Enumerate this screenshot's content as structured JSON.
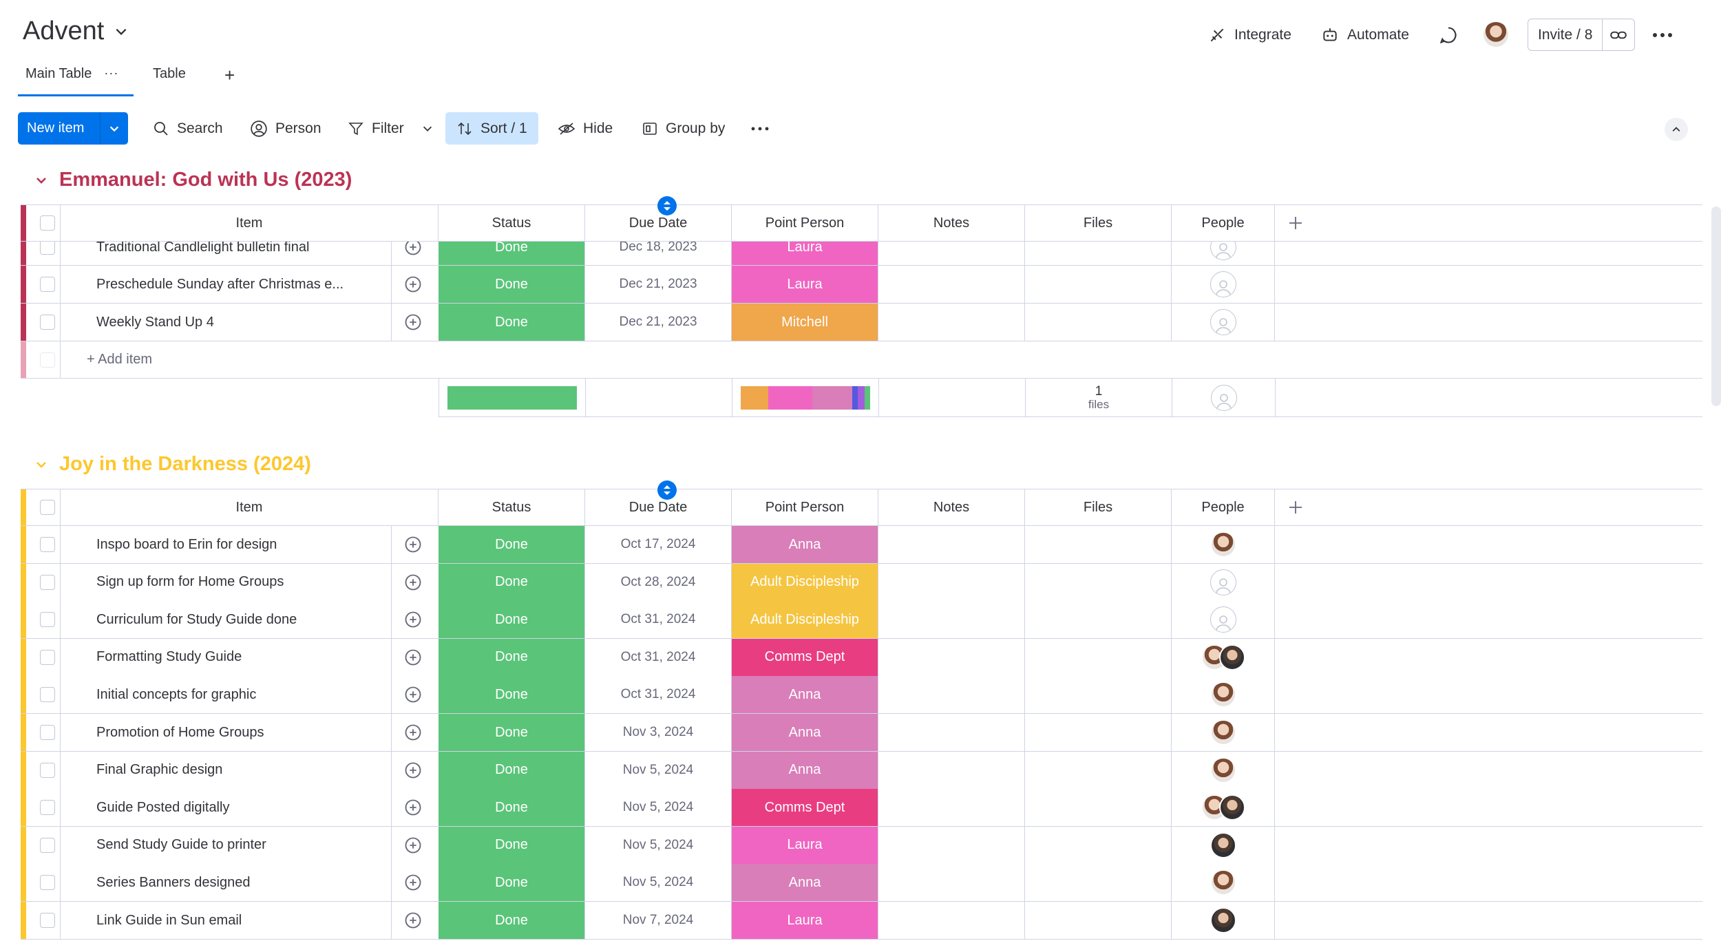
{
  "header": {
    "board_title": "Advent",
    "integrate_label": "Integrate",
    "automate_label": "Automate",
    "invite_label": "Invite / 8"
  },
  "tabs": [
    {
      "label": "Main Table",
      "active": true
    },
    {
      "label": "Table",
      "active": false
    }
  ],
  "toolbar": {
    "new_item_label": "New item",
    "search_label": "Search",
    "person_label": "Person",
    "filter_label": "Filter",
    "sort_label": "Sort / 1",
    "hide_label": "Hide",
    "group_by_label": "Group by"
  },
  "columns": {
    "item": "Item",
    "status": "Status",
    "due_date": "Due Date",
    "point_person": "Point Person",
    "notes": "Notes",
    "files": "Files",
    "people": "People"
  },
  "colors": {
    "done": "#5ac479",
    "laura": "#f065c2",
    "mitchell": "#f0a64b",
    "anna": "#d97eb8",
    "adult_discipleship": "#f5c542",
    "comms_dept": "#e93d82",
    "group1_accent": "#bb3354",
    "group2_accent": "#fdc72d",
    "primary": "#0073ea"
  },
  "groups": [
    {
      "title": "Emmanuel: God with Us (2023)",
      "title_color": "#bb3354",
      "rows": [
        {
          "item": "Traditional Candlelight bulletin final",
          "status": "Done",
          "due": "Dec 18, 2023",
          "pp": "Laura",
          "pp_color": "#f065c2",
          "people": [
            "empty"
          ]
        },
        {
          "item": "Preschedule Sunday after Christmas e...",
          "status": "Done",
          "due": "Dec 21, 2023",
          "pp": "Laura",
          "pp_color": "#f065c2",
          "people": [
            "empty"
          ]
        },
        {
          "item": "Weekly Stand Up 4",
          "status": "Done",
          "due": "Dec 21, 2023",
          "pp": "Mitchell",
          "pp_color": "#f0a64b",
          "people": [
            "empty"
          ]
        }
      ],
      "add_item_label": "+ Add item",
      "summary": {
        "files_count": "1",
        "files_label": "files"
      }
    },
    {
      "title": "Joy in the Darkness (2024)",
      "title_color": "#fdc72d",
      "rows": [
        {
          "item": "Inspo board to Erin for design",
          "status": "Done",
          "due": "Oct 17, 2024",
          "pp": "Anna",
          "pp_color": "#d97eb8",
          "people": [
            "anna"
          ]
        },
        {
          "item": "Sign up form for Home Groups",
          "status": "Done",
          "due": "Oct 28, 2024",
          "pp": "Adult Discipleship",
          "pp_color": "#f5c542",
          "people": [
            "empty"
          ]
        },
        {
          "item": "Curriculum for Study Guide done",
          "status": "Done",
          "due": "Oct 31, 2024",
          "pp": "Adult Discipleship",
          "pp_color": "#f5c542",
          "people": [
            "empty"
          ]
        },
        {
          "item": "Formatting Study Guide",
          "status": "Done",
          "due": "Oct 31, 2024",
          "pp": "Comms Dept",
          "pp_color": "#e93d82",
          "people": [
            "anna",
            "laura"
          ]
        },
        {
          "item": "Initial concepts for graphic",
          "status": "Done",
          "due": "Oct 31, 2024",
          "pp": "Anna",
          "pp_color": "#d97eb8",
          "people": [
            "anna"
          ]
        },
        {
          "item": "Promotion of Home Groups",
          "status": "Done",
          "due": "Nov 3, 2024",
          "pp": "Anna",
          "pp_color": "#d97eb8",
          "people": [
            "anna"
          ]
        },
        {
          "item": "Final Graphic design",
          "status": "Done",
          "due": "Nov 5, 2024",
          "pp": "Anna",
          "pp_color": "#d97eb8",
          "people": [
            "anna"
          ]
        },
        {
          "item": "Guide Posted digitally",
          "status": "Done",
          "due": "Nov 5, 2024",
          "pp": "Comms Dept",
          "pp_color": "#e93d82",
          "people": [
            "anna",
            "laura"
          ]
        },
        {
          "item": "Send Study Guide to printer",
          "status": "Done",
          "due": "Nov 5, 2024",
          "pp": "Laura",
          "pp_color": "#f065c2",
          "people": [
            "laura"
          ]
        },
        {
          "item": "Series Banners designed",
          "status": "Done",
          "due": "Nov 5, 2024",
          "pp": "Anna",
          "pp_color": "#d97eb8",
          "people": [
            "anna"
          ]
        },
        {
          "item": "Link Guide in Sun email",
          "status": "Done",
          "due": "Nov 7, 2024",
          "pp": "Laura",
          "pp_color": "#f065c2",
          "people": [
            "laura"
          ]
        }
      ]
    }
  ]
}
